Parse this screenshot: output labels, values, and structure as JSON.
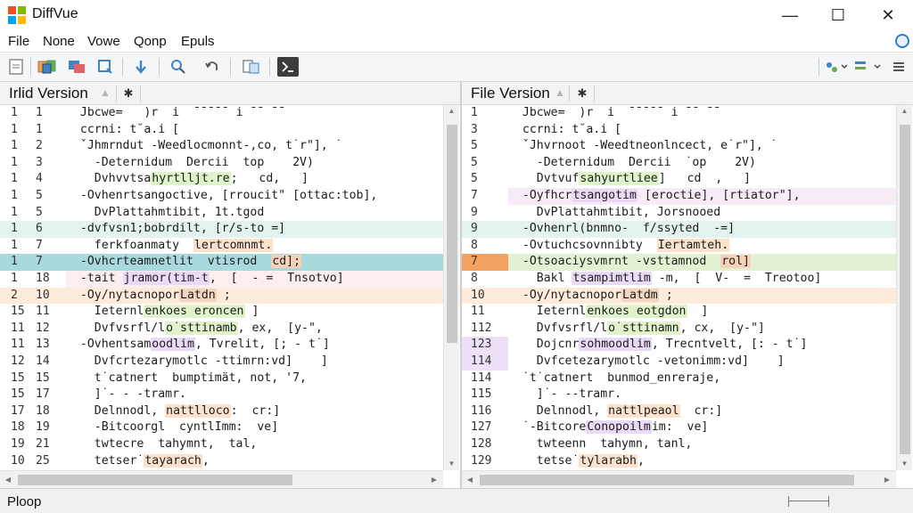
{
  "window": {
    "title": "DiffVue",
    "controls": {
      "minimize": "—",
      "maximize": "☐",
      "close": "✕"
    }
  },
  "menu": [
    "File",
    "None",
    "Vowe",
    "Qonp",
    "Epuls"
  ],
  "toolbar": {
    "left_buttons": [
      "new-file-icon",
      "compare-icon",
      "copy-icon",
      "refresh-icon",
      "next-diff-icon",
      "zoom-icon",
      "undo-icon",
      "settings-icon",
      "panel-icon"
    ],
    "right_buttons": [
      "sync-icon",
      "merge-icon"
    ]
  },
  "left_pane": {
    "title": "Irlid Version",
    "lines": [
      {
        "n1": "1",
        "n2": "1",
        "bg": "",
        "num_bg": "",
        "parts": [
          {
            "t": "  Jbcwe=   )"
          },
          {
            "t": "r"
          },
          {
            "t": "  i"
          },
          {
            "t": "  ˉˉˉˉˉ i ˉˉ ˉˉ"
          }
        ]
      },
      {
        "n1": "1",
        "n2": "1",
        "bg": "",
        "num_bg": "",
        "parts": [
          {
            "t": "  ccrni: t˘a.i ["
          }
        ]
      },
      {
        "n1": "1",
        "n2": "2",
        "bg": "",
        "num_bg": "",
        "parts": [
          {
            "t": "  ˇJhmrndut ‐Weedlocmonnt‐,co, t˙r\"], ˙"
          }
        ]
      },
      {
        "n1": "1",
        "n2": "3",
        "bg": "",
        "num_bg": "",
        "parts": [
          {
            "t": "    ‐Deternidum  Dercii  top    2V)"
          }
        ]
      },
      {
        "n1": "1",
        "n2": "4",
        "bg": "",
        "num_bg": "",
        "parts": [
          {
            "t": "    Dvhvvtsa"
          },
          {
            "t": "hyrtlljt.re",
            "h": "#dff5c9"
          },
          {
            "t": ";   cd,   ]                   ]"
          }
        ]
      },
      {
        "n1": "1",
        "n2": "5",
        "bg": "",
        "num_bg": "",
        "parts": [
          {
            "t": "  ‐Ovhenrtsangoctive, [rroucit\" [ottac:tob],"
          }
        ]
      },
      {
        "n1": "1",
        "n2": "5",
        "bg": "",
        "num_bg": "",
        "parts": [
          {
            "t": "    DvPlattahmtibit, 1t.tgod"
          }
        ]
      },
      {
        "n1": "1",
        "n2": "6",
        "bg": "#e4f2f0",
        "num_bg": "#e4f2f0",
        "parts": [
          {
            "t": "  ‐dvfvsn1;bobrdilt, [r/s‐to =]"
          }
        ]
      },
      {
        "n1": "1",
        "n2": "7",
        "bg": "",
        "num_bg": "",
        "parts": [
          {
            "t": "    ferkfoanmaty  "
          },
          {
            "t": "lertcomnmt.",
            "h": "#fbe2cc"
          }
        ]
      },
      {
        "n1": "1",
        "n2": "7",
        "bg": "#a8d9dd",
        "num_bg": "#a8d9dd",
        "parts": [
          {
            "t": "  ‐Ovhcrteamnetlit  vtisrod  ",
            "h": ""
          },
          {
            "t": "cd];",
            "h": "#f7d0b8"
          }
        ]
      },
      {
        "n1": "1",
        "n2": "18",
        "bg": "#fbeeee",
        "num_bg": "",
        "parts": [
          {
            "t": "  ‐tait "
          },
          {
            "t": "jramor(tim‐t",
            "h": "#e9dbf7"
          },
          {
            "t": ",  [  ‐ =  Tnsotvo]"
          }
        ]
      },
      {
        "n1": "2",
        "n2": "10",
        "bg": "#fdebdc",
        "num_bg": "#fdebdc",
        "parts": [
          {
            "t": "  ‐Oy/nytacnopor"
          },
          {
            "t": "Latdn",
            "h": "#f3d6c2"
          },
          {
            "t": " ;"
          }
        ]
      },
      {
        "n1": "15",
        "n2": "11",
        "bg": "",
        "num_bg": "",
        "parts": [
          {
            "t": "    Ieternl"
          },
          {
            "t": "enkoes eroncen",
            "h": "#e1f3cb"
          },
          {
            "t": " ]"
          }
        ]
      },
      {
        "n1": "11",
        "n2": "12",
        "bg": "",
        "num_bg": "",
        "parts": [
          {
            "t": "    Dvfvsrfl/l"
          },
          {
            "t": "o˙sttinamb",
            "h": "#e1f3cb"
          },
          {
            "t": ", ex,  [y‐\","
          }
        ]
      },
      {
        "n1": "11",
        "n2": "13",
        "bg": "",
        "num_bg": "",
        "parts": [
          {
            "t": "  ‐Ovhentsam"
          },
          {
            "t": "oodlim",
            "h": "#e9dbf7"
          },
          {
            "t": ", Tvrelit, [; ‐ t˙]"
          }
        ]
      },
      {
        "n1": "12",
        "n2": "14",
        "bg": "",
        "num_bg": "",
        "parts": [
          {
            "t": "    Dvfcrtezarymotlc ‐ttimrn:vd]    ]"
          }
        ]
      },
      {
        "n1": "15",
        "n2": "15",
        "bg": "",
        "num_bg": "",
        "parts": [
          {
            "t": "    t˙catnert  bumptimät, not, '7,"
          }
        ]
      },
      {
        "n1": "15",
        "n2": "17",
        "bg": "",
        "num_bg": "",
        "parts": [
          {
            "t": "    ]˙‐ ‐ ‐tramr."
          }
        ]
      },
      {
        "n1": "17",
        "n2": "18",
        "bg": "",
        "num_bg": "",
        "parts": [
          {
            "t": "    Delnnodl, "
          },
          {
            "t": "nattlloco",
            "h": "#fbe2cc"
          },
          {
            "t": ":  cr:]"
          }
        ]
      },
      {
        "n1": "18",
        "n2": "19",
        "bg": "",
        "num_bg": "",
        "parts": [
          {
            "t": "    ‐Bitcoorgl  cyntlImm:  ve]"
          }
        ]
      },
      {
        "n1": "19",
        "n2": "21",
        "bg": "",
        "num_bg": "",
        "parts": [
          {
            "t": "    twtecre  tahymnt,  tal,"
          }
        ]
      },
      {
        "n1": "10",
        "n2": "25",
        "bg": "",
        "num_bg": "",
        "parts": [
          {
            "t": "    tetser˙"
          },
          {
            "t": "tayarach",
            "h": "#fbe2cc"
          },
          {
            "t": ","
          }
        ]
      },
      {
        "n1": "",
        "n2": "",
        "bg": "",
        "num_bg": "",
        "parts": [
          {
            "t": "    br=˙s=  r0"
          }
        ]
      }
    ]
  },
  "right_pane": {
    "title": "File Version",
    "lines": [
      {
        "n": "1",
        "bg": "",
        "num_bg": "",
        "parts": [
          {
            "t": "  Jbcwe=  )r"
          },
          {
            "t": "  i"
          },
          {
            "t": "  ˉˉˉˉˉ i ˉˉ ˉˉ"
          }
        ]
      },
      {
        "n": "3",
        "bg": "",
        "num_bg": "",
        "parts": [
          {
            "t": "  ccrni: t˘a.i ["
          }
        ]
      },
      {
        "n": "5",
        "bg": "",
        "num_bg": "",
        "parts": [
          {
            "t": "  ˇJhvrnoot ‐Weedtneonlncect, e˙r\"], ˙"
          }
        ]
      },
      {
        "n": "5",
        "bg": "",
        "num_bg": "",
        "parts": [
          {
            "t": "    ‐Deternidum  Dercii  ˙op    2V)"
          }
        ]
      },
      {
        "n": "5",
        "bg": "",
        "num_bg": "",
        "parts": [
          {
            "t": "    Dvtvuf"
          },
          {
            "t": "sahyurtliee",
            "h": "#dff5c9"
          },
          {
            "t": "]   cd  ,   ]"
          }
        ]
      },
      {
        "n": "7",
        "bg": "#f8ebf8",
        "num_bg": "",
        "parts": [
          {
            "t": "  ‐Oyfhcr"
          },
          {
            "t": "tsangotim",
            "h": "#ecd9f5"
          },
          {
            "t": " [eroctie], [rtiator\"],"
          }
        ]
      },
      {
        "n": "9",
        "bg": "",
        "num_bg": "",
        "parts": [
          {
            "t": "    DvPlattahmtibit, Jorsnooed"
          }
        ]
      },
      {
        "n": "9",
        "bg": "#e4f2f0",
        "num_bg": "#e4f2f0",
        "parts": [
          {
            "t": "  ‐Ovhenrl(bnmno‐  f/ssyted  ‐=]"
          }
        ]
      },
      {
        "n": "8",
        "bg": "",
        "num_bg": "",
        "parts": [
          {
            "t": "  ‐Ovtuchcsovnnibty  "
          },
          {
            "t": "Iertamteh.",
            "h": "#fbe2cc"
          }
        ]
      },
      {
        "n": "7",
        "bg": "#e3f1d3",
        "num_bg": "#f4a261",
        "parts": [
          {
            "t": "  ‐Otsoaciysvmrnt ‐vsttamnod  ",
            "h": ""
          },
          {
            "t": "rol]",
            "h": "#f7d0b8"
          }
        ]
      },
      {
        "n": "8",
        "bg": "",
        "num_bg": "",
        "parts": [
          {
            "t": "    Bakl "
          },
          {
            "t": "tsampimtlim",
            "h": "#e9dbf7"
          },
          {
            "t": " ‐m,  [  V‐  =  Treotoo]"
          }
        ]
      },
      {
        "n": "10",
        "bg": "#fdebdc",
        "num_bg": "#fdebdc",
        "parts": [
          {
            "t": "  ‐Oy/nytacnopor"
          },
          {
            "t": "Latdm",
            "h": "#f3d6c2"
          },
          {
            "t": " ;"
          }
        ]
      },
      {
        "n": "11",
        "bg": "",
        "num_bg": "",
        "parts": [
          {
            "t": "    Ieternl"
          },
          {
            "t": "enkoes eotgdon",
            "h": "#e1f3cb"
          },
          {
            "t": "  ]"
          }
        ]
      },
      {
        "n": "112",
        "bg": "",
        "num_bg": "",
        "parts": [
          {
            "t": "    Dvfvsrfl/l"
          },
          {
            "t": "o˙sttinamn",
            "h": "#e1f3cb"
          },
          {
            "t": ", cx,  [y‐\"]"
          }
        ]
      },
      {
        "n": "123",
        "bg": "",
        "num_bg": "#ece1f7",
        "parts": [
          {
            "t": "    Dojcnr"
          },
          {
            "t": "sohmoodlim",
            "h": "#e9dbf7"
          },
          {
            "t": ", Trecntvelt, [: ‐ t˙]"
          }
        ]
      },
      {
        "n": "114",
        "bg": "",
        "num_bg": "#ece1f7",
        "parts": [
          {
            "t": "    Dvfcetezarymotlc ‐vetonimm:vd]    ]"
          }
        ]
      },
      {
        "n": "114",
        "bg": "",
        "num_bg": "",
        "parts": [
          {
            "t": "  ˙t˙catnert  bunmod_enreraje,"
          }
        ]
      },
      {
        "n": "115",
        "bg": "",
        "num_bg": "",
        "parts": [
          {
            "t": "    ]˙‐ ‐‐tramr."
          }
        ]
      },
      {
        "n": "116",
        "bg": "",
        "num_bg": "",
        "parts": [
          {
            "t": "    Delnnodl, "
          },
          {
            "t": "nattlpeaol",
            "h": "#fbe2cc"
          },
          {
            "t": "  cr:]"
          }
        ]
      },
      {
        "n": "127",
        "bg": "",
        "num_bg": "",
        "parts": [
          {
            "t": "  ˙‐Bitcore"
          },
          {
            "t": "Conopoilm",
            "h": "#e9dbf7"
          },
          {
            "t": "im:  ve]"
          }
        ]
      },
      {
        "n": "128",
        "bg": "",
        "num_bg": "",
        "parts": [
          {
            "t": "    twteenn  tahymn, tanl,"
          }
        ]
      },
      {
        "n": "129",
        "bg": "",
        "num_bg": "",
        "parts": [
          {
            "t": "    tetse˙"
          },
          {
            "t": "tylarabh",
            "h": "#fbe2cc"
          },
          {
            "t": ","
          }
        ]
      },
      {
        "n": "",
        "bg": "",
        "num_bg": "",
        "parts": [
          {
            "t": "    b˙=˙s=  r0"
          }
        ]
      }
    ]
  },
  "status": {
    "text": "Ploop"
  },
  "colors": {
    "accent": "#2b7bd6",
    "changed_line": "#fdebdc",
    "moved_line": "#a8d9dd",
    "added_line": "#e3f1d3",
    "current_line_marker": "#f4a261"
  }
}
